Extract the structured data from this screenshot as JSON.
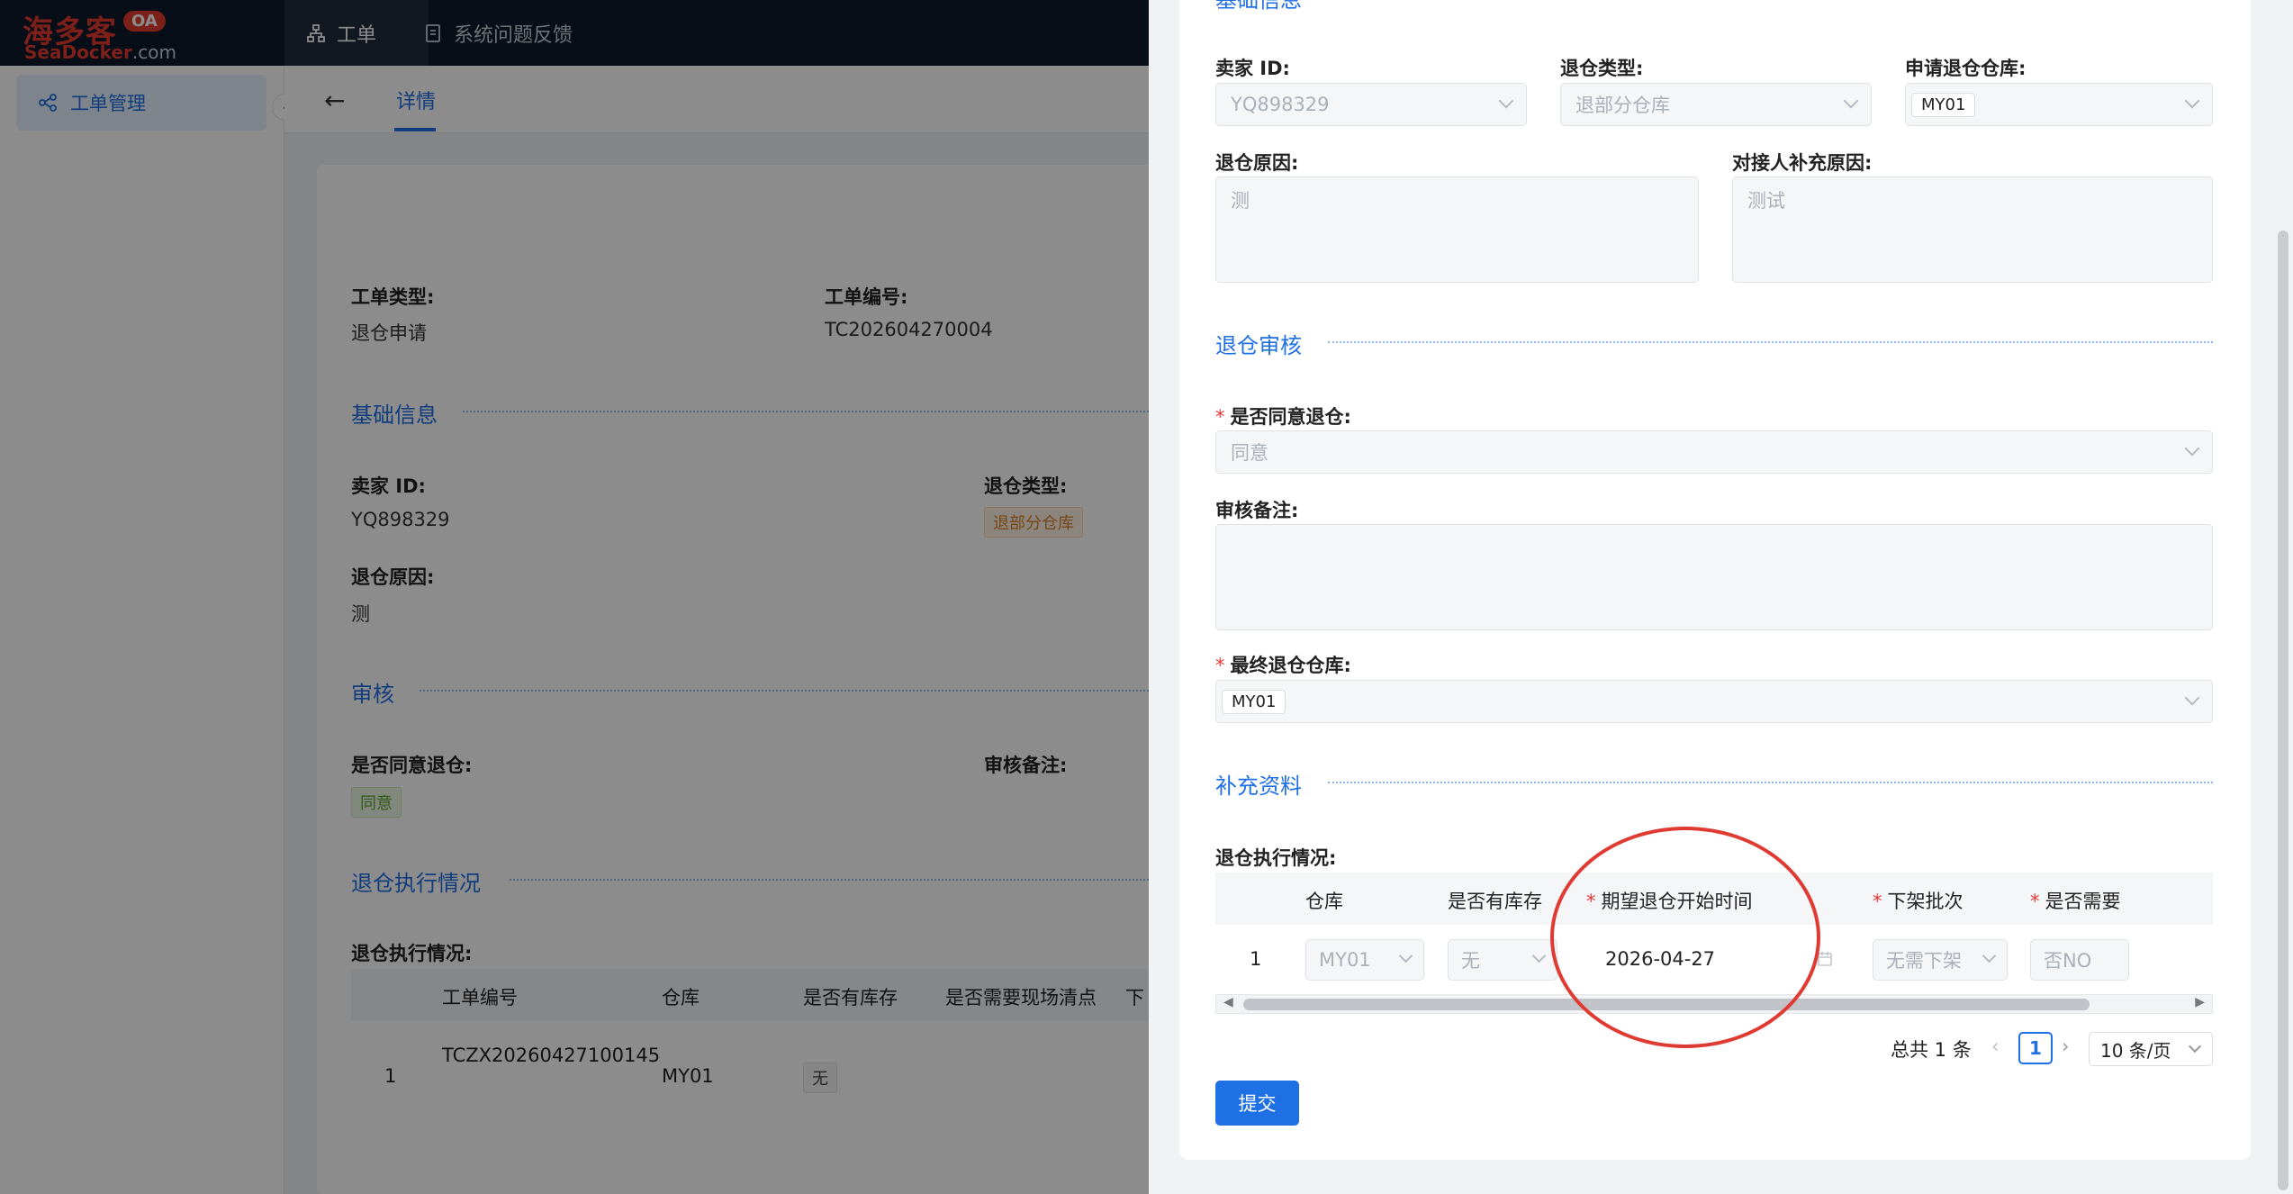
{
  "app": {
    "logo_cn": "海多客",
    "logo_oa": "OA",
    "logo_en_brand": "SeaDocker",
    "logo_en_suffix": ".com",
    "nav_tabs": [
      {
        "label": "工单",
        "icon": "org-chart-icon",
        "active": true
      },
      {
        "label": "系统问题反馈",
        "icon": "document-icon",
        "active": false
      }
    ]
  },
  "sidebar": {
    "items": [
      {
        "label": "工单管理",
        "icon": "workflow-icon",
        "active": true
      }
    ],
    "collapse_glyph": "‹"
  },
  "page_header": {
    "back_glyph": "←",
    "tab": "详情"
  },
  "detail": {
    "order_type_label": "工单类型:",
    "order_type_value": "退仓申请",
    "order_no_label": "工单编号:",
    "order_no_value": "TC202604270004",
    "basic_section": "基础信息",
    "seller_id_label": "卖家 ID:",
    "seller_id_value": "YQ898329",
    "return_type_label": "退仓类型:",
    "return_type_value": "退部分仓库",
    "reason_label": "退仓原因:",
    "reason_value": "测",
    "audit_section": "审核",
    "agree_label": "是否同意退仓:",
    "agree_value": "同意",
    "audit_note_label": "审核备注:",
    "exec_section": "退仓执行情况",
    "exec_label": "退仓执行情况:",
    "table": {
      "headers": [
        "工单编号",
        "仓库",
        "是否有库存",
        "是否需要现场清点",
        "下"
      ],
      "rows": [
        {
          "index": "1",
          "order_no": "TCZX20260427100145",
          "warehouse": "MY01",
          "stock": "无"
        }
      ]
    }
  },
  "drawer": {
    "top_section_partial": "基础信息",
    "seller_id_label": "卖家 ID:",
    "seller_id_value": "YQ898329",
    "return_type_label": "退仓类型:",
    "return_type_value": "退部分仓库",
    "apply_wh_label": "申请退仓仓库:",
    "apply_wh_value": "MY01",
    "reason_label": "退仓原因:",
    "reason_value": "测",
    "supplement_reason_label": "对接人补充原因:",
    "supplement_reason_value": "测试",
    "audit_section": "退仓审核",
    "agree_label": "是否同意退仓:",
    "agree_value": "同意",
    "audit_note_label": "审核备注:",
    "final_wh_label": "最终退仓仓库:",
    "final_wh_value": "MY01",
    "extra_section": "补充资料",
    "exec_label": "退仓执行情况:",
    "table": {
      "headers": [
        "仓库",
        "是否有库存",
        "期望退仓开始时间",
        "下架批次",
        "是否需要"
      ],
      "required": [
        false,
        false,
        true,
        true,
        true
      ],
      "row": {
        "index": "1",
        "warehouse": "MY01",
        "stock": "无",
        "start_date": "2026-04-27",
        "batch": "无需下架",
        "need": "否NO"
      }
    },
    "pagination": {
      "total": "总共 1 条",
      "page": "1",
      "page_size": "10 条/页"
    },
    "submit": "提交",
    "required_mark": "*"
  },
  "colors": {
    "accent": "#1f6fe5",
    "topbar": "#0d1b2c",
    "annotation": "#e03b33",
    "required": "#e4393c"
  }
}
